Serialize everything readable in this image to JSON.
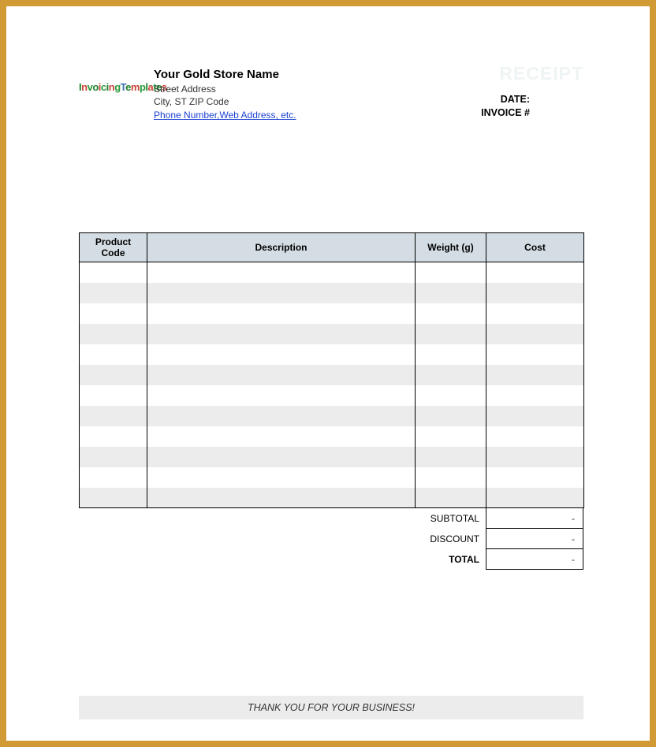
{
  "header": {
    "store_name": "Your Gold Store Name",
    "street_address": "Street Address",
    "city_line": "City, ST  ZIP Code",
    "contact_link": "Phone Number,Web Address, etc.",
    "logo_text": "InvoicingTemplates",
    "receipt_title": "RECEIPT",
    "date_label": "DATE:",
    "invoice_label": "INVOICE #"
  },
  "columns": {
    "code": "Product Code",
    "description": "Description",
    "weight": "Weight (g)",
    "cost": "Cost"
  },
  "rows": [
    {
      "code": "",
      "description": "",
      "weight": "",
      "cost": ""
    },
    {
      "code": "",
      "description": "",
      "weight": "",
      "cost": ""
    },
    {
      "code": "",
      "description": "",
      "weight": "",
      "cost": ""
    },
    {
      "code": "",
      "description": "",
      "weight": "",
      "cost": ""
    },
    {
      "code": "",
      "description": "",
      "weight": "",
      "cost": ""
    },
    {
      "code": "",
      "description": "",
      "weight": "",
      "cost": ""
    },
    {
      "code": "",
      "description": "",
      "weight": "",
      "cost": ""
    },
    {
      "code": "",
      "description": "",
      "weight": "",
      "cost": ""
    },
    {
      "code": "",
      "description": "",
      "weight": "",
      "cost": ""
    },
    {
      "code": "",
      "description": "",
      "weight": "",
      "cost": ""
    },
    {
      "code": "",
      "description": "",
      "weight": "",
      "cost": ""
    },
    {
      "code": "",
      "description": "",
      "weight": "",
      "cost": ""
    }
  ],
  "totals": {
    "subtotal_label": "SUBTOTAL",
    "subtotal_value": "-",
    "discount_label": "DISCOUNT",
    "discount_value": "-",
    "total_label": "TOTAL",
    "total_value": "-"
  },
  "footer": {
    "thanks": "THANK YOU FOR YOUR BUSINESS!"
  }
}
